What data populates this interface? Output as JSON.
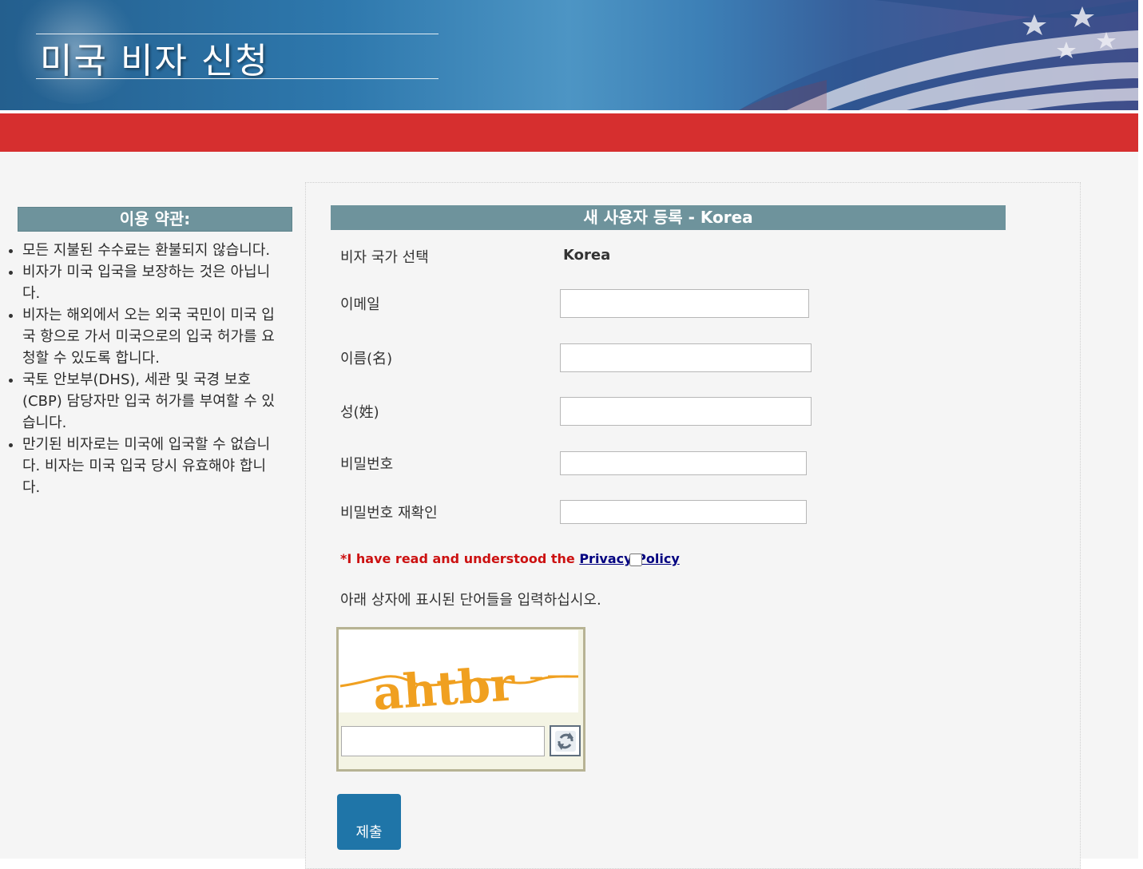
{
  "header": {
    "title": "미국 비자 신청"
  },
  "sidebar": {
    "terms_title": "이용 약관:",
    "terms": [
      "모든 지불된 수수료는 환불되지 않습니다.",
      "비자가 미국 입국을 보장하는 것은 아닙니다.",
      "비자는 해외에서 오는 외국 국민이 미국 입국 항으로 가서 미국으로의 입국 허가를 요청할 수 있도록 합니다.",
      "국토 안보부(DHS), 세관 및 국경 보호(CBP) 담당자만 입국 허가를 부여할 수 있습니다.",
      "만기된 비자로는 미국에 입국할 수 없습니다. 비자는 미국 입국 당시 유효해야 합니다."
    ]
  },
  "form": {
    "title": "새 사용자 등록 - Korea",
    "country_label": "비자 국가 선택",
    "country_value": "Korea",
    "email_label": "이메일",
    "email_value": "",
    "first_name_label": "이름(名)",
    "first_name_value": "",
    "last_name_label": "성(姓)",
    "last_name_value": "",
    "password_label": "비밀번호",
    "password_value": "",
    "password_confirm_label": "비밀번호 재확인",
    "password_confirm_value": "",
    "privacy_prefix": "*I have read and understood the ",
    "privacy_link": "Privacy Policy",
    "privacy_checked": false,
    "captcha_instruction": "아래 상자에 표시된 단어들을 입력하십시오.",
    "captcha_text": "ahtbr",
    "captcha_value": "",
    "refresh_icon": "refresh-icon",
    "submit_label": "제출"
  },
  "colors": {
    "header_blue": "#2e78ad",
    "red_bar": "#d62f2f",
    "section_header": "#6e939c",
    "submit": "#1f75a8",
    "privacy_text": "#cc1111",
    "captcha_orange": "#f0a020"
  }
}
